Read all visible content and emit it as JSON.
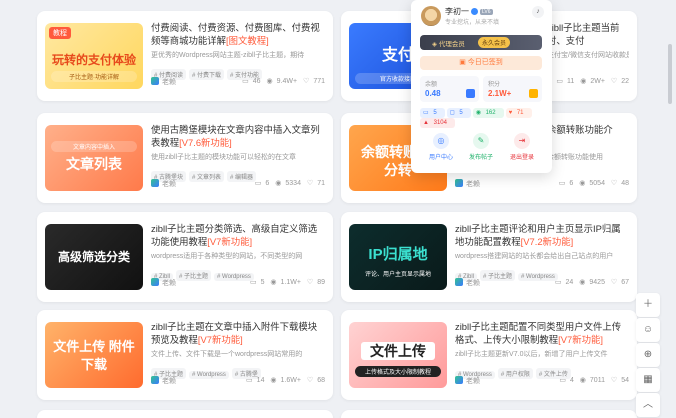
{
  "cards": [
    {
      "title": "付费阅读、付费资源、付费图库、付费视频等商城功能详解",
      "highlight": "[图文教程]",
      "desc": "更优秀的Wordpress网站主题-zibll子比主题，期待",
      "tags": [
        "# 付费阅读",
        "# 付费下载",
        "# 支付功能"
      ],
      "author": "老赖",
      "stats": {
        "comments": "46",
        "views": "9.4W+",
        "likes": "771"
      },
      "thumb": {
        "text": "玩转的支付体验",
        "chip": "教程",
        "sub": "子比主题·功能详解"
      }
    },
    {
      "title": "zibll子比主题当前时、支付",
      "highlight": "最新",
      "desc": "支付宝/微信支付网站收款是",
      "tags": [],
      "author": "老赖",
      "stats": {
        "comments": "11",
        "views": "2W+",
        "likes": "22"
      },
      "thumb": {
        "text": "支付",
        "chip": "",
        "sub": "官方收款接口"
      }
    },
    {
      "title": "使用古腾堡模块在文章内容中插入文章列表教程",
      "highlight": "[V7.6新功能]",
      "desc": "使用zibll子比主题的模块功能可以轻松的在文章",
      "tags": [
        "# 古腾堡块",
        "# 文章列表",
        "# 编辑器"
      ],
      "author": "老赖",
      "stats": {
        "comments": "6",
        "views": "5334",
        "likes": "71"
      },
      "thumb": {
        "text": "文章列表",
        "chip": "",
        "sub": "文章内容中插入"
      }
    },
    {
      "title": "余额转账功能介",
      "highlight": "",
      "desc": "余额转账功能使用",
      "tags": [],
      "author": "老赖",
      "stats": {
        "comments": "6",
        "views": "5054",
        "likes": "48"
      },
      "thumb": {
        "text": "余额转账 积分转",
        "chip": "",
        "sub": ""
      }
    },
    {
      "title": "zibll子比主题分类筛选、高级自定义筛选功能使用教程",
      "highlight": "[V7新功能]",
      "desc": "wordpress适用于各种类型的网站，不同类型的网",
      "tags": [
        "# Zibll",
        "# 子比主题",
        "# Wordpress"
      ],
      "author": "老赖",
      "stats": {
        "comments": "5",
        "views": "1.1W+",
        "likes": "89"
      },
      "thumb": {
        "text": "高级筛选分类",
        "chip": "",
        "sub": ""
      }
    },
    {
      "title": "zibll子比主题评论和用户主页显示IP归属地功能配置教程",
      "highlight": "[V7.2新功能]",
      "desc": "wordpress搭建网站的站长都会给出自己站点的用户",
      "tags": [
        "# Zibll",
        "# 子比主题",
        "# Wordpress"
      ],
      "author": "老赖",
      "stats": {
        "comments": "24",
        "views": "9425",
        "likes": "67"
      },
      "thumb": {
        "text": "IP归属地",
        "chip": "",
        "sub": "评论、用户主页显示属地"
      }
    },
    {
      "title": "zibll子比主题在文章中插入附件下载模块预览及教程",
      "highlight": "[V7新功能]",
      "desc": "文件上传、文件下载是一个wordpress网站常用的",
      "tags": [
        "# 子比主题",
        "# Wordpress",
        "# 古腾堡"
      ],
      "author": "老赖",
      "stats": {
        "comments": "14",
        "views": "1.6W+",
        "likes": "68"
      },
      "thumb": {
        "text": "文件上传 附件下载",
        "chip": "",
        "sub": ""
      }
    },
    {
      "title": "zibll子比主题配置不同类型用户文件上传格式、上传大小限制教程",
      "highlight": "[V7新功能]",
      "desc": "zibll子比主题更新V7.0以后，新增了用户上传文件",
      "tags": [
        "# Wordpress",
        "# 用户权限",
        "# 文件上传"
      ],
      "author": "老赖",
      "stats": {
        "comments": "4",
        "views": "7011",
        "likes": "54"
      },
      "thumb": {
        "text": "文件上传",
        "chip": "",
        "sub": "上传格式及大小限制教程"
      }
    }
  ],
  "popup": {
    "username": "李初一",
    "level": "LV6",
    "signature": "专业挖坑，从来不填",
    "vip_label": "代理会员",
    "vip_expiry": "永久会员",
    "checkin": "今日已签到",
    "balance_label": "余额",
    "balance_value": "0.48",
    "points_label": "积分",
    "points_value": "2.1W+",
    "counts": [
      "5",
      "5",
      "162",
      "71",
      "3104"
    ],
    "actions": [
      "用户中心",
      "发布帖子",
      "退出登录"
    ],
    "colors": {
      "accent": "#ff5b3b",
      "vip_gold": "#f5d38b"
    }
  },
  "floatbar": [
    "＋",
    "☺",
    "⊕",
    "▦",
    "︿"
  ]
}
